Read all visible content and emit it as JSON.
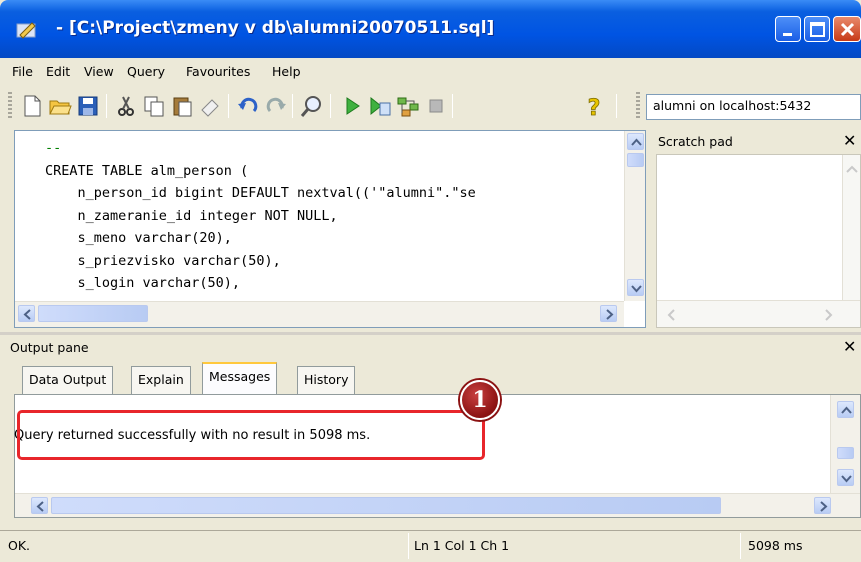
{
  "window": {
    "title": "- [C:\\Project\\zmeny v db\\alumni20070511.sql]"
  },
  "menu": {
    "items": [
      "File",
      "Edit",
      "View",
      "Query",
      "Favourites",
      "Help"
    ]
  },
  "toolbar": {
    "connection": "alumni on localhost:5432"
  },
  "editor": {
    "lines": [
      "--",
      "CREATE TABLE alm_person (",
      "    n_person_id bigint DEFAULT nextval(('\"alumni\".\"se",
      "    n_zameranie_id integer NOT NULL,",
      "    s_meno varchar(20),",
      "    s_priezvisko varchar(50),",
      "    s_login varchar(50),"
    ]
  },
  "scratch_pad": {
    "title": "Scratch pad"
  },
  "output_pane": {
    "title": "Output pane",
    "tabs": [
      "Data Output",
      "Explain",
      "Messages",
      "History"
    ],
    "active_tab": "Messages",
    "message": "Query returned successfully with no result in 5098 ms.",
    "callout_number": "1"
  },
  "status": {
    "state": "OK.",
    "position": "Ln 1 Col 1 Ch 1",
    "time": "5098 ms"
  }
}
